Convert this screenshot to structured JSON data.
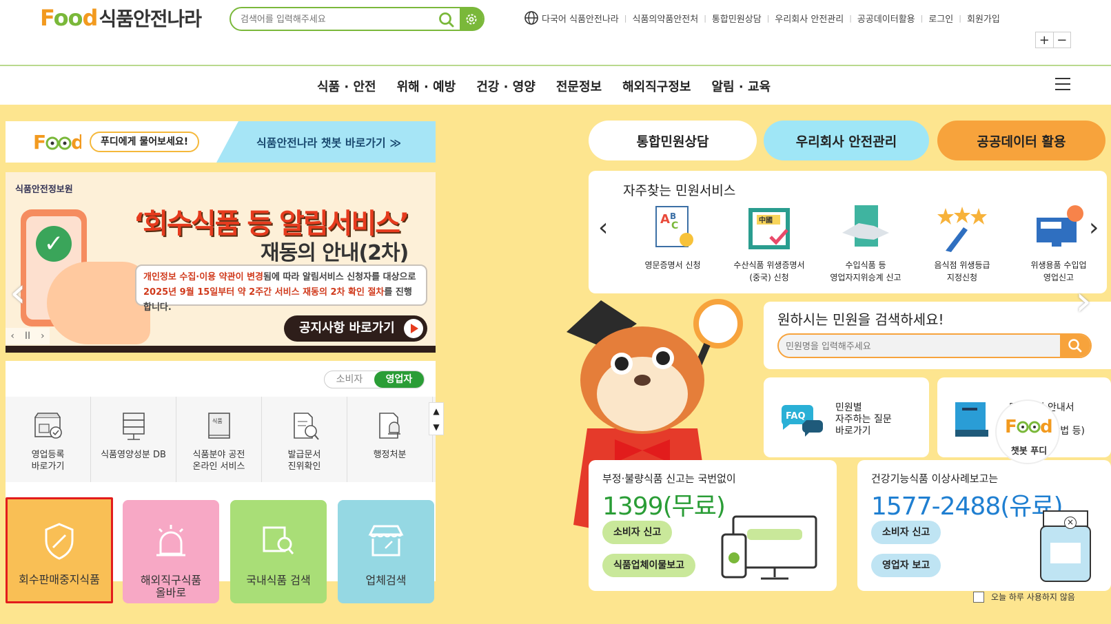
{
  "header": {
    "logo_en": "Food",
    "logo_ko": "식품안전나라",
    "search_placeholder": "검색어를 입력해주세요",
    "utility_links": [
      "다국어 식품안전나라",
      "식품의약품안전처",
      "통합민원상담",
      "우리회사 안전관리",
      "공공데이터활용",
      "로그인",
      "회원가입"
    ],
    "zoom_in": "+",
    "zoom_out": "−"
  },
  "gnb": {
    "items": [
      "식품 · 안전",
      "위해 · 예방",
      "건강 · 영양",
      "전문정보",
      "해외직구정보",
      "알림 · 교육"
    ]
  },
  "chatbot_banner": {
    "bubble": "푸디에게 물어보세요!",
    "link": "식품안전나라 챗봇 바로가기 ≫"
  },
  "banner": {
    "org": "식품안전정보원",
    "title1": "‘회수식품 등 알림서비스’",
    "title2": "재동의 안내(2차)",
    "notice_line1_red": "개인정보 수집·이용 약관이 변경",
    "notice_line1_rest": "됨에 따라 알림서비스 신청자를 대상으로",
    "notice_line2_red": "2025년 9월 15일부터 약 2주간 서비스 재동의 2차 확인 절차",
    "notice_line2_rest": "를 진행합니다.",
    "button": "공지사항 바로가기"
  },
  "biz": {
    "toggle_consumer": "소비자",
    "toggle_business": "영업자",
    "items": [
      {
        "label": "영업등록\n바로가기",
        "icon": "store-icon"
      },
      {
        "label": "식품영양성분 DB",
        "icon": "database-icon"
      },
      {
        "label": "식품분야 공전\n온라인 서비스",
        "icon": "book-icon"
      },
      {
        "label": "발급문서\n진위확인",
        "icon": "document-check-icon"
      },
      {
        "label": "행정처분",
        "icon": "alert-icon"
      }
    ]
  },
  "tiles": {
    "recall": "회수판매중지식품",
    "overseas": "해외직구식품\n올바로",
    "domestic": "국내식품 검색",
    "company": "업체검색"
  },
  "right": {
    "pill_civil": "통합민원상담",
    "pill_company": "우리회사 안전관리",
    "pill_data": "공공데이터 활용",
    "faq_title": "자주찾는 민원서비스",
    "services": [
      {
        "label": "영문증명서 신청",
        "icon": "certificate-icon"
      },
      {
        "label": "수산식품 위생증명서\n(중국) 신청",
        "icon": "china-cert-icon"
      },
      {
        "label": "수입식품 등\n영업자지위승계 신고",
        "icon": "handshake-icon"
      },
      {
        "label": "음식점 위생등급\n지정신청",
        "icon": "stars-icon"
      },
      {
        "label": "위생용품 수입업\n영업신고",
        "icon": "monitor-icon"
      }
    ],
    "search_title": "원하시는 민원을 검색하세요!",
    "search_placeholder": "민원명을 입력해주세요",
    "card_faq": "민원별\n자주하는 질문\n바로가기",
    "card_guide": "민원신청 안내서\n바로가기\n(영업신고 방법 등)",
    "report1_heading": "부정·불량식품 신고는 국번없이",
    "report1_number": "1399(무료)",
    "report1_btn1": "소비자 신고",
    "report1_btn2": "식품업체이물보고",
    "report2_heading": "건강기능식품 이상사례보고는",
    "report2_number": "1577-2488(유료)",
    "report2_btn1": "소비자 신고",
    "report2_btn2": "영업자 보고"
  },
  "chatbot_float": {
    "label": "챗봇 푸디",
    "close": "×",
    "today_close": "오늘 하루 사용하지 않음"
  }
}
